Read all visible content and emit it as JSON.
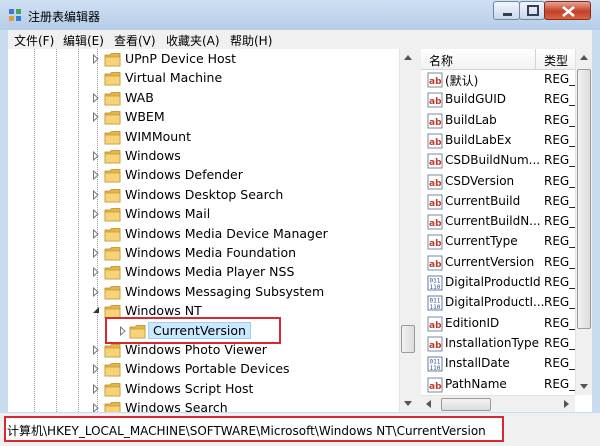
{
  "window": {
    "title": "注册表编辑器",
    "icon": "regedit-icon",
    "controls": {
      "minimize": "minimize-icon",
      "maximize": "maximize-icon",
      "close": "close-icon"
    }
  },
  "menu": {
    "items": [
      {
        "label": "文件(F)"
      },
      {
        "label": "编辑(E)"
      },
      {
        "label": "查看(V)"
      },
      {
        "label": "收藏夹(A)"
      },
      {
        "label": "帮助(H)"
      }
    ]
  },
  "tree": {
    "items": [
      {
        "label": "UPnP Device Host",
        "expander": "collapsed"
      },
      {
        "label": "Virtual Machine",
        "expander": "none"
      },
      {
        "label": "WAB",
        "expander": "collapsed"
      },
      {
        "label": "WBEM",
        "expander": "collapsed"
      },
      {
        "label": "WIMMount",
        "expander": "none"
      },
      {
        "label": "Windows",
        "expander": "collapsed"
      },
      {
        "label": "Windows Defender",
        "expander": "collapsed"
      },
      {
        "label": "Windows Desktop Search",
        "expander": "collapsed"
      },
      {
        "label": "Windows Mail",
        "expander": "collapsed"
      },
      {
        "label": "Windows Media Device Manager",
        "expander": "collapsed"
      },
      {
        "label": "Windows Media Foundation",
        "expander": "collapsed"
      },
      {
        "label": "Windows Media Player NSS",
        "expander": "collapsed"
      },
      {
        "label": "Windows Messaging Subsystem",
        "expander": "collapsed"
      },
      {
        "label": "Windows NT",
        "expander": "expanded"
      },
      {
        "label": "CurrentVersion",
        "expander": "collapsed",
        "selected": true
      },
      {
        "label": "Windows Photo Viewer",
        "expander": "collapsed"
      },
      {
        "label": "Windows Portable Devices",
        "expander": "collapsed"
      },
      {
        "label": "Windows Script Host",
        "expander": "collapsed"
      },
      {
        "label": "Windows Search",
        "expander": "collapsed"
      }
    ]
  },
  "values": {
    "columns": {
      "name": "名称",
      "type": "类型"
    },
    "rows": [
      {
        "name": "(默认)",
        "type": "REG_",
        "icon": "string-value-icon"
      },
      {
        "name": "BuildGUID",
        "type": "REG_",
        "icon": "string-value-icon"
      },
      {
        "name": "BuildLab",
        "type": "REG_",
        "icon": "string-value-icon"
      },
      {
        "name": "BuildLabEx",
        "type": "REG_",
        "icon": "string-value-icon"
      },
      {
        "name": "CSDBuildNum...",
        "type": "REG_",
        "icon": "string-value-icon"
      },
      {
        "name": "CSDVersion",
        "type": "REG_",
        "icon": "string-value-icon"
      },
      {
        "name": "CurrentBuild",
        "type": "REG_",
        "icon": "string-value-icon"
      },
      {
        "name": "CurrentBuildN...",
        "type": "REG_",
        "icon": "string-value-icon"
      },
      {
        "name": "CurrentType",
        "type": "REG_",
        "icon": "string-value-icon"
      },
      {
        "name": "CurrentVersion",
        "type": "REG_",
        "icon": "string-value-icon"
      },
      {
        "name": "DigitalProductId",
        "type": "REG_",
        "icon": "binary-value-icon"
      },
      {
        "name": "DigitalProductI...",
        "type": "REG_",
        "icon": "binary-value-icon"
      },
      {
        "name": "EditionID",
        "type": "REG_",
        "icon": "string-value-icon"
      },
      {
        "name": "InstallationType",
        "type": "REG_",
        "icon": "string-value-icon"
      },
      {
        "name": "InstallDate",
        "type": "REG_",
        "icon": "binary-value-icon"
      },
      {
        "name": "PathName",
        "type": "REG_",
        "icon": "string-value-icon"
      }
    ]
  },
  "status": {
    "path": "计算机\\HKEY_LOCAL_MACHINE\\SOFTWARE\\Microsoft\\Windows NT\\CurrentVersion"
  },
  "colors": {
    "highlight": "#d9282f",
    "selection": "#cce8ff",
    "folder": "#e8b84a"
  }
}
